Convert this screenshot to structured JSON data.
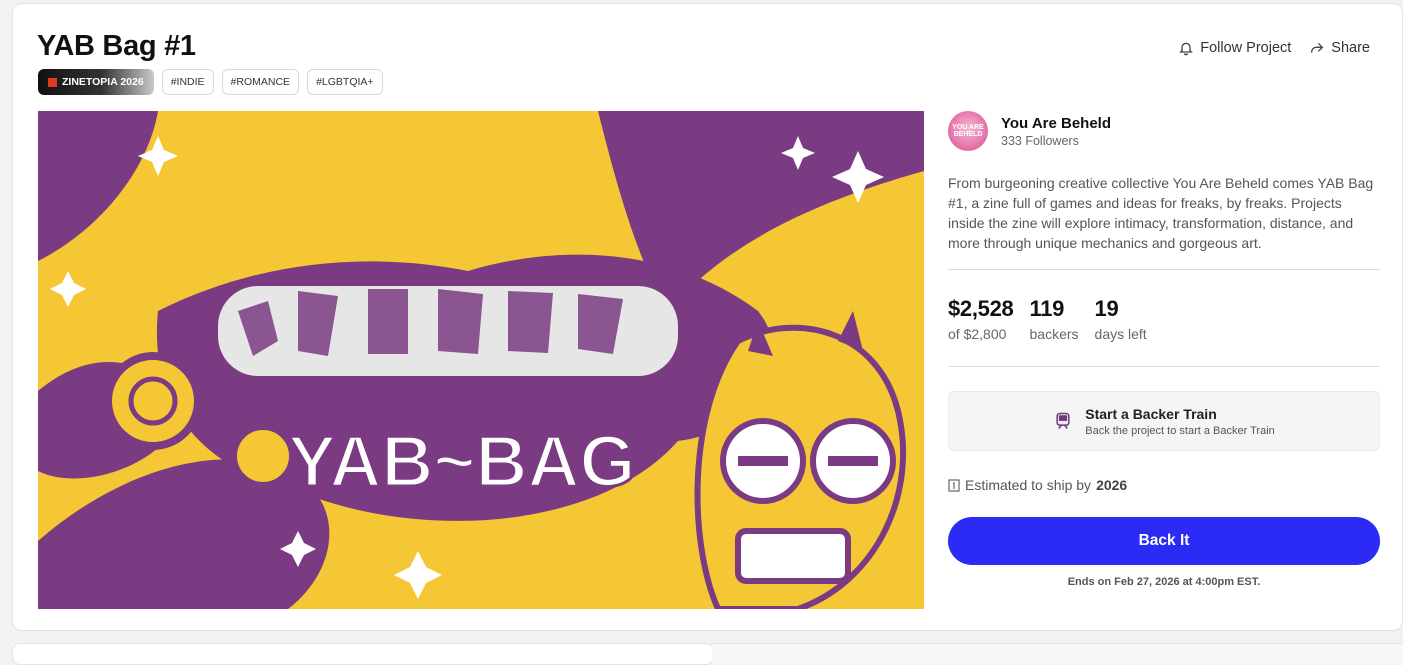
{
  "project": {
    "title": "YAB Bag #1",
    "tags": [
      {
        "label": "ZINETOPIA 2026",
        "featured": true
      },
      {
        "label": "#INDIE"
      },
      {
        "label": "#ROMANCE"
      },
      {
        "label": "#LGBTQIA+"
      }
    ]
  },
  "actions": {
    "follow_label": "Follow Project",
    "share_label": "Share"
  },
  "hero": {
    "logo_text": "YAB~BAG",
    "colors": {
      "yellow": "#f6c735",
      "purple": "#7a3b82",
      "white": "#ffffff",
      "grey": "#e6e6e6"
    }
  },
  "creator": {
    "name": "You Are Beheld",
    "followers": "333 Followers",
    "avatar_text": "YOU ARE BEHELD"
  },
  "description": "From burgeoning creative collective You Are Beheld comes YAB Bag #1, a zine full of games and ideas for freaks, by freaks. Projects inside the zine will explore intimacy, transformation, distance, and more through unique mechanics and gorgeous art.",
  "stats": {
    "pledged": "$2,528",
    "goal": "of $2,800",
    "backers": "119",
    "backers_label": "backers",
    "days": "19",
    "days_label": "days left"
  },
  "backer_train": {
    "title": "Start a Backer Train",
    "subtitle": "Back the project to start a Backer Train"
  },
  "shipping": {
    "prefix": "Estimated to ship by",
    "year": "2026"
  },
  "cta": {
    "back_label": "Back It",
    "ends": "Ends on Feb 27, 2026 at 4:00pm EST."
  },
  "brand_color": "#2b2bf5"
}
